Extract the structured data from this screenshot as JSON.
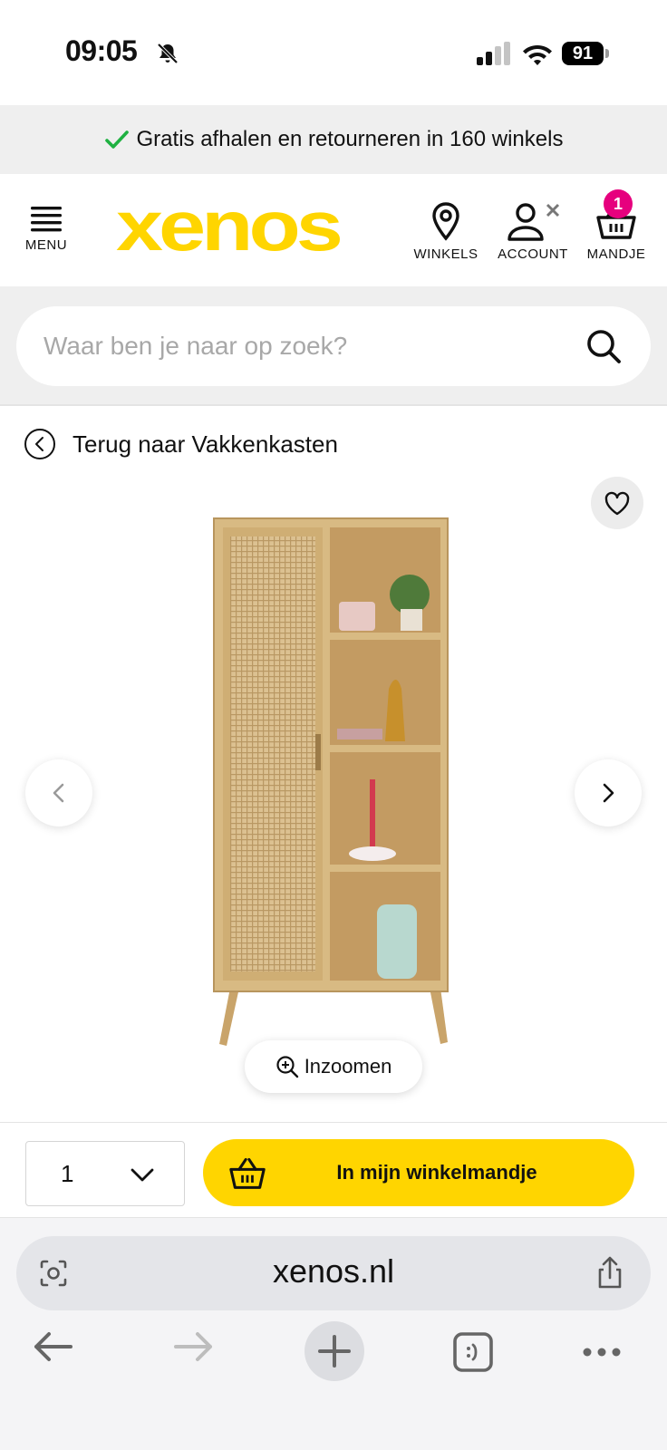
{
  "status_bar": {
    "time": "09:05",
    "battery": "91"
  },
  "promo": {
    "text": "Gratis afhalen en retourneren in 160 winkels"
  },
  "header": {
    "menu_label": "MENU",
    "logo_text": "xenos",
    "stores_label": "WINKELS",
    "account_label": "ACCOUNT",
    "cart_label": "MANDJE",
    "cart_count": "1"
  },
  "search": {
    "placeholder": "Waar ben je naar op zoek?"
  },
  "breadcrumb": {
    "back_label": "Terug naar Vakkenkasten"
  },
  "gallery": {
    "zoom_label": "Inzoomen"
  },
  "purchase": {
    "quantity": "1",
    "add_label": "In mijn winkelmandje"
  },
  "browser": {
    "url": "xenos.nl"
  },
  "colors": {
    "brand_yellow": "#ffd500",
    "badge_pink": "#e6007e",
    "check_green": "#1fb141"
  }
}
